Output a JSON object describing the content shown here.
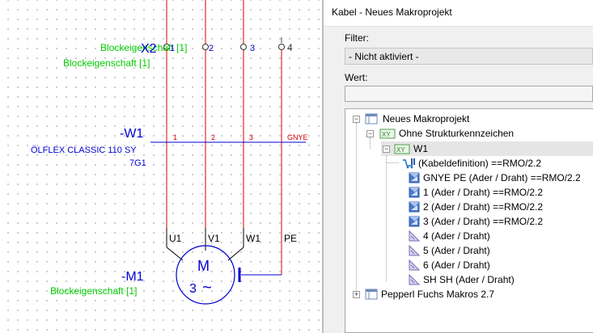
{
  "schematic": {
    "terminal_label": "X2",
    "terminal_overlay_text": "Blockeigenschaft [1]",
    "terminal_numbers": [
      "1",
      "2",
      "3",
      "4"
    ],
    "block_property_top": "Blockeigenschaft [1]",
    "cable": {
      "name": "-W1",
      "type": "ÖLFLEX CLASSIC 110 SY",
      "cross_section": "7G1",
      "wire_labels": [
        "1",
        "2",
        "3",
        "GNYE"
      ]
    },
    "motor": {
      "name": "-M1",
      "block_property": "Blockeigenschaft [1]",
      "terminals": [
        "U1",
        "V1",
        "W1",
        "PE"
      ],
      "symbol_top": "M",
      "symbol_bottom": "3",
      "ac_symbol": "~"
    },
    "colors": {
      "red": "#d40000",
      "blue": "#0000d0",
      "green": "#00cc00",
      "line": "#000000"
    }
  },
  "panel": {
    "title": "Kabel - Neues Makroprojekt",
    "filter_label": "Filter:",
    "filter_value": "- Nicht aktiviert -",
    "value_label": "Wert:",
    "value_text": "",
    "tree": {
      "root": "Neues Makroprojekt",
      "structure": "Ohne Strukturkennzeichen",
      "cable": "W1",
      "items": [
        "(Kabeldefinition) ==RMO/2.2",
        "GNYE PE (Ader / Draht) ==RMO/2.2",
        "1 (Ader / Draht) ==RMO/2.2",
        "2 (Ader / Draht) ==RMO/2.2",
        "3 (Ader / Draht) ==RMO/2.2",
        "4 (Ader / Draht)",
        "5 (Ader / Draht)",
        "6 (Ader / Draht)",
        "SH SH (Ader / Draht)"
      ],
      "second_root": "Pepperl Fuchs Makros 2.7"
    }
  }
}
